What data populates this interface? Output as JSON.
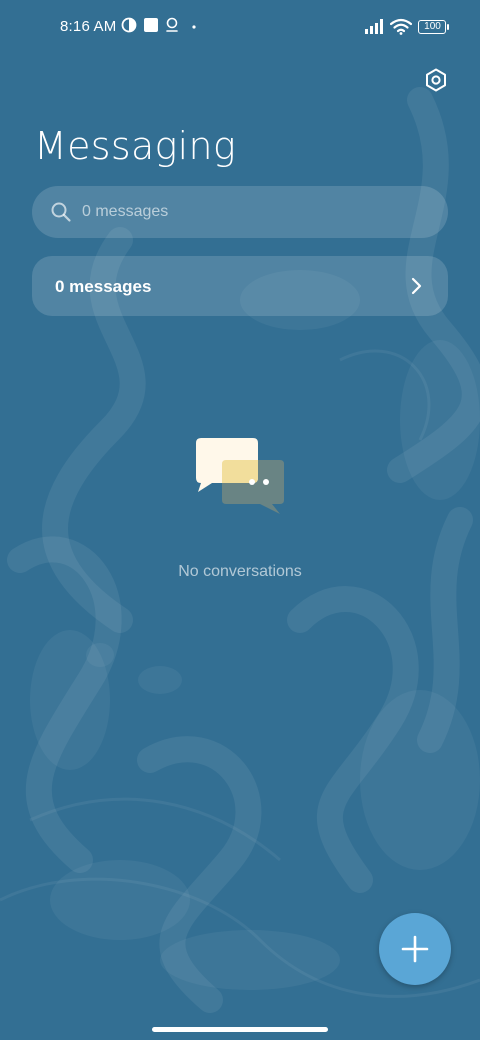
{
  "status_bar": {
    "time": "8:16 AM",
    "battery": "100",
    "icons": [
      "vpn-icon",
      "square-icon",
      "location-icon",
      "dot-icon",
      "signal-icon",
      "wifi-icon",
      "battery-icon"
    ]
  },
  "header": {
    "title": "Messaging",
    "settings_icon": "settings-icon"
  },
  "search": {
    "placeholder": "0 messages"
  },
  "messages_row": {
    "label": "0 messages"
  },
  "empty_state": {
    "text": "No conversations",
    "icon": "chat-bubbles-icon"
  },
  "fab": {
    "icon": "plus-icon"
  },
  "colors": {
    "background": "#336f93",
    "fab": "#5aa6d6",
    "bubble_front": "#fff8ea",
    "bubble_back": "#e8d79a"
  }
}
